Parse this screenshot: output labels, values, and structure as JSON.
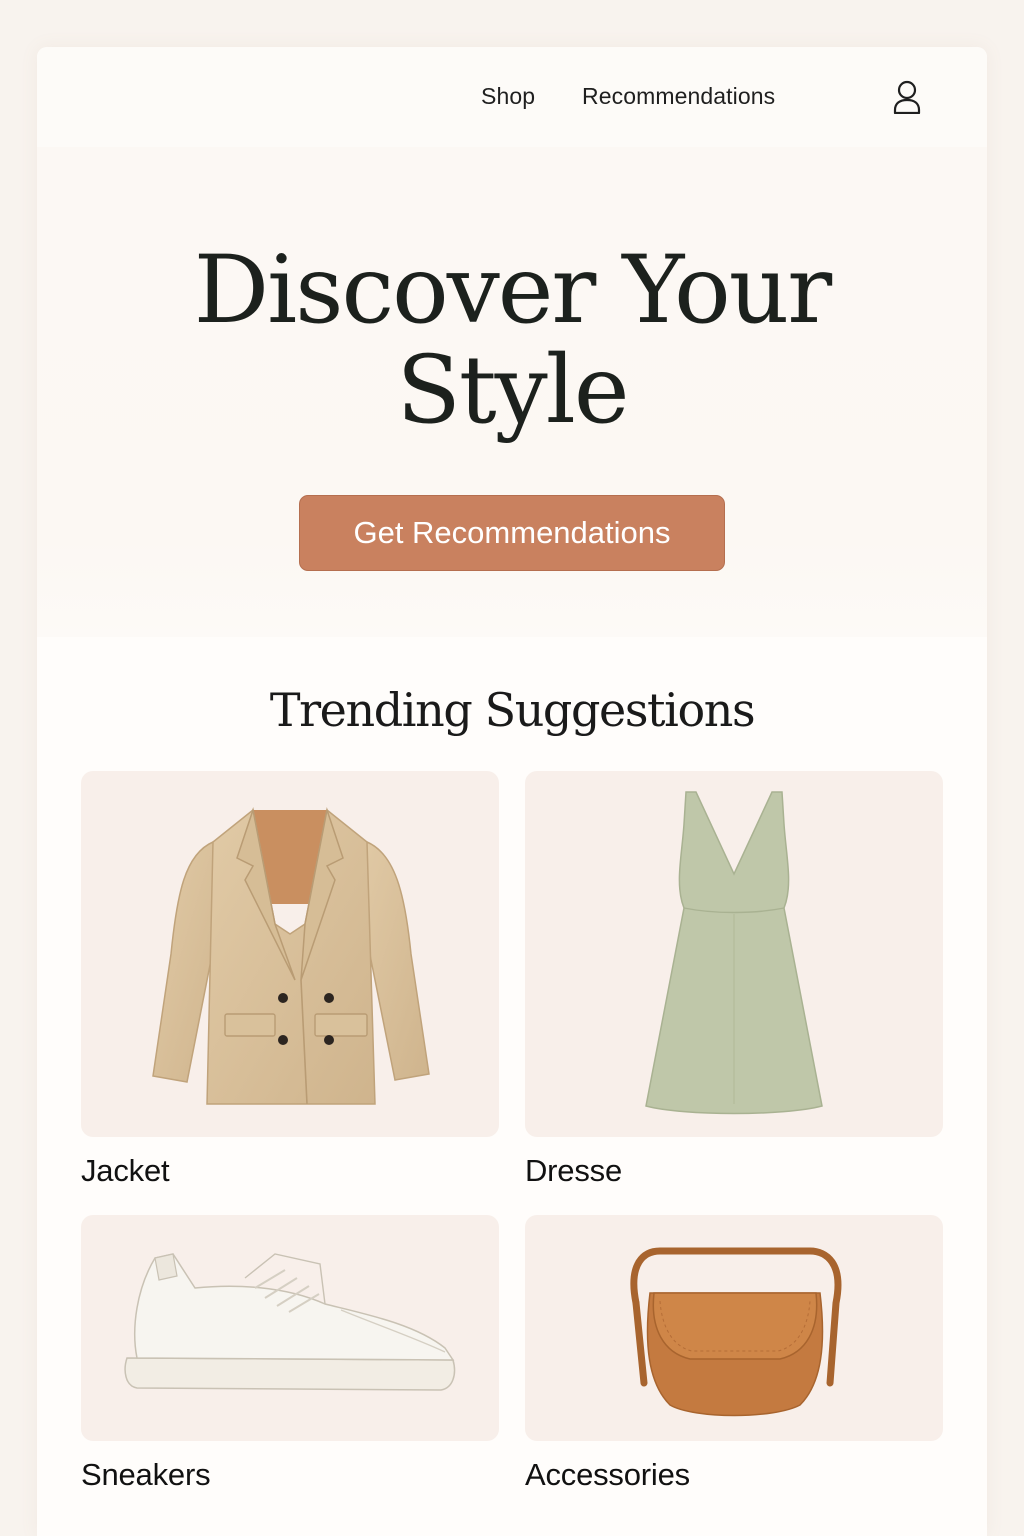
{
  "nav": {
    "shop": "Shop",
    "recommendations": "Recommendations",
    "profile_icon": "user-icon"
  },
  "hero": {
    "title_line1": "Discover Your",
    "title_line2": "Style",
    "cta": "Get Recommendations"
  },
  "trending": {
    "title": "Trending Suggestions",
    "items": [
      {
        "label": "Jacket",
        "icon": "jacket-image"
      },
      {
        "label": "Dresse",
        "icon": "dress-image"
      },
      {
        "label": "Sneakers",
        "icon": "sneaker-image"
      },
      {
        "label": "Accessories",
        "icon": "bag-image"
      }
    ]
  },
  "colors": {
    "background": "#f8f3ee",
    "accent": "#c9815f",
    "card_bg": "#f8efea",
    "text": "#1c211d"
  }
}
